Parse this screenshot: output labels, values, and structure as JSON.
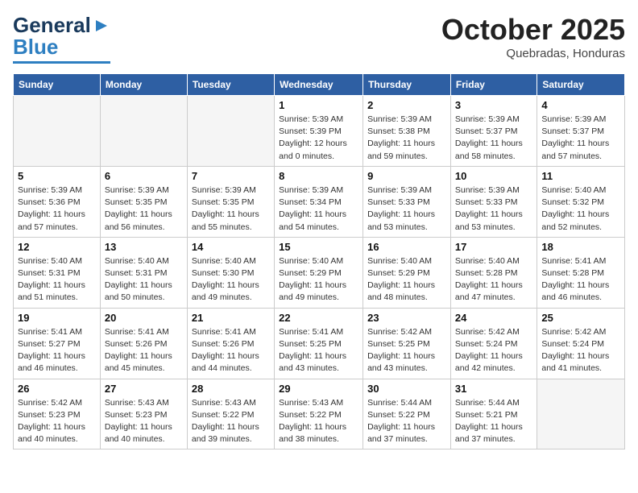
{
  "header": {
    "logo_general": "General",
    "logo_blue": "Blue",
    "month_title": "October 2025",
    "subtitle": "Quebradas, Honduras"
  },
  "weekdays": [
    "Sunday",
    "Monday",
    "Tuesday",
    "Wednesday",
    "Thursday",
    "Friday",
    "Saturday"
  ],
  "weeks": [
    [
      {
        "day": "",
        "info": ""
      },
      {
        "day": "",
        "info": ""
      },
      {
        "day": "",
        "info": ""
      },
      {
        "day": "1",
        "info": "Sunrise: 5:39 AM\nSunset: 5:39 PM\nDaylight: 12 hours\nand 0 minutes."
      },
      {
        "day": "2",
        "info": "Sunrise: 5:39 AM\nSunset: 5:38 PM\nDaylight: 11 hours\nand 59 minutes."
      },
      {
        "day": "3",
        "info": "Sunrise: 5:39 AM\nSunset: 5:37 PM\nDaylight: 11 hours\nand 58 minutes."
      },
      {
        "day": "4",
        "info": "Sunrise: 5:39 AM\nSunset: 5:37 PM\nDaylight: 11 hours\nand 57 minutes."
      }
    ],
    [
      {
        "day": "5",
        "info": "Sunrise: 5:39 AM\nSunset: 5:36 PM\nDaylight: 11 hours\nand 57 minutes."
      },
      {
        "day": "6",
        "info": "Sunrise: 5:39 AM\nSunset: 5:35 PM\nDaylight: 11 hours\nand 56 minutes."
      },
      {
        "day": "7",
        "info": "Sunrise: 5:39 AM\nSunset: 5:35 PM\nDaylight: 11 hours\nand 55 minutes."
      },
      {
        "day": "8",
        "info": "Sunrise: 5:39 AM\nSunset: 5:34 PM\nDaylight: 11 hours\nand 54 minutes."
      },
      {
        "day": "9",
        "info": "Sunrise: 5:39 AM\nSunset: 5:33 PM\nDaylight: 11 hours\nand 53 minutes."
      },
      {
        "day": "10",
        "info": "Sunrise: 5:39 AM\nSunset: 5:33 PM\nDaylight: 11 hours\nand 53 minutes."
      },
      {
        "day": "11",
        "info": "Sunrise: 5:40 AM\nSunset: 5:32 PM\nDaylight: 11 hours\nand 52 minutes."
      }
    ],
    [
      {
        "day": "12",
        "info": "Sunrise: 5:40 AM\nSunset: 5:31 PM\nDaylight: 11 hours\nand 51 minutes."
      },
      {
        "day": "13",
        "info": "Sunrise: 5:40 AM\nSunset: 5:31 PM\nDaylight: 11 hours\nand 50 minutes."
      },
      {
        "day": "14",
        "info": "Sunrise: 5:40 AM\nSunset: 5:30 PM\nDaylight: 11 hours\nand 49 minutes."
      },
      {
        "day": "15",
        "info": "Sunrise: 5:40 AM\nSunset: 5:29 PM\nDaylight: 11 hours\nand 49 minutes."
      },
      {
        "day": "16",
        "info": "Sunrise: 5:40 AM\nSunset: 5:29 PM\nDaylight: 11 hours\nand 48 minutes."
      },
      {
        "day": "17",
        "info": "Sunrise: 5:40 AM\nSunset: 5:28 PM\nDaylight: 11 hours\nand 47 minutes."
      },
      {
        "day": "18",
        "info": "Sunrise: 5:41 AM\nSunset: 5:28 PM\nDaylight: 11 hours\nand 46 minutes."
      }
    ],
    [
      {
        "day": "19",
        "info": "Sunrise: 5:41 AM\nSunset: 5:27 PM\nDaylight: 11 hours\nand 46 minutes."
      },
      {
        "day": "20",
        "info": "Sunrise: 5:41 AM\nSunset: 5:26 PM\nDaylight: 11 hours\nand 45 minutes."
      },
      {
        "day": "21",
        "info": "Sunrise: 5:41 AM\nSunset: 5:26 PM\nDaylight: 11 hours\nand 44 minutes."
      },
      {
        "day": "22",
        "info": "Sunrise: 5:41 AM\nSunset: 5:25 PM\nDaylight: 11 hours\nand 43 minutes."
      },
      {
        "day": "23",
        "info": "Sunrise: 5:42 AM\nSunset: 5:25 PM\nDaylight: 11 hours\nand 43 minutes."
      },
      {
        "day": "24",
        "info": "Sunrise: 5:42 AM\nSunset: 5:24 PM\nDaylight: 11 hours\nand 42 minutes."
      },
      {
        "day": "25",
        "info": "Sunrise: 5:42 AM\nSunset: 5:24 PM\nDaylight: 11 hours\nand 41 minutes."
      }
    ],
    [
      {
        "day": "26",
        "info": "Sunrise: 5:42 AM\nSunset: 5:23 PM\nDaylight: 11 hours\nand 40 minutes."
      },
      {
        "day": "27",
        "info": "Sunrise: 5:43 AM\nSunset: 5:23 PM\nDaylight: 11 hours\nand 40 minutes."
      },
      {
        "day": "28",
        "info": "Sunrise: 5:43 AM\nSunset: 5:22 PM\nDaylight: 11 hours\nand 39 minutes."
      },
      {
        "day": "29",
        "info": "Sunrise: 5:43 AM\nSunset: 5:22 PM\nDaylight: 11 hours\nand 38 minutes."
      },
      {
        "day": "30",
        "info": "Sunrise: 5:44 AM\nSunset: 5:22 PM\nDaylight: 11 hours\nand 37 minutes."
      },
      {
        "day": "31",
        "info": "Sunrise: 5:44 AM\nSunset: 5:21 PM\nDaylight: 11 hours\nand 37 minutes."
      },
      {
        "day": "",
        "info": ""
      }
    ]
  ]
}
